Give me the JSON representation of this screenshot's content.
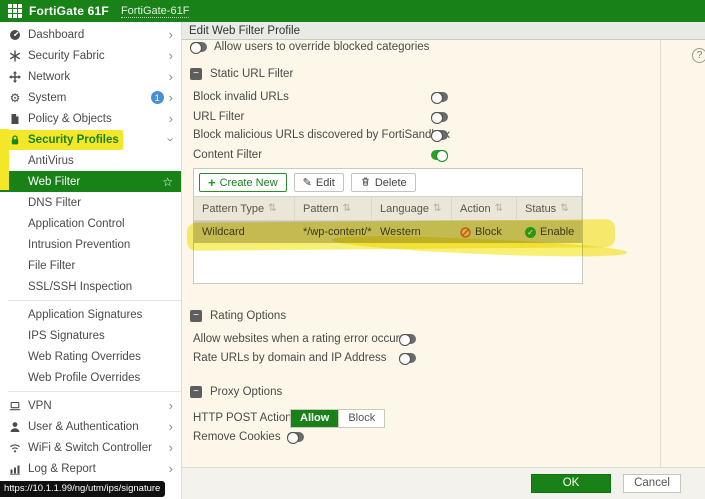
{
  "topbar": {
    "product": "FortiGate 61F",
    "hostname": "FortiGate-61F"
  },
  "sidebar": {
    "items": [
      {
        "label": "Dashboard"
      },
      {
        "label": "Security Fabric"
      },
      {
        "label": "Network"
      },
      {
        "label": "System",
        "badge": "1"
      },
      {
        "label": "Policy & Objects"
      },
      {
        "label": "Security Profiles"
      },
      {
        "label": "AntiVirus"
      },
      {
        "label": "Web Filter"
      },
      {
        "label": "DNS Filter"
      },
      {
        "label": "Application Control"
      },
      {
        "label": "Intrusion Prevention"
      },
      {
        "label": "File Filter"
      },
      {
        "label": "SSL/SSH Inspection"
      },
      {
        "label": "Application Signatures"
      },
      {
        "label": "IPS Signatures"
      },
      {
        "label": "Web Rating Overrides"
      },
      {
        "label": "Web Profile Overrides"
      },
      {
        "label": "VPN"
      },
      {
        "label": "User & Authentication"
      },
      {
        "label": "WiFi & Switch Controller"
      },
      {
        "label": "Log & Report"
      }
    ]
  },
  "page": {
    "title": "Edit Web Filter Profile"
  },
  "override_row": {
    "label": "Allow users to override blocked categories",
    "state": "off"
  },
  "static_url_filter": {
    "title": "Static URL Filter",
    "fields": [
      {
        "label": "Block invalid URLs",
        "state": "off"
      },
      {
        "label": "URL Filter",
        "state": "off"
      },
      {
        "label": "Block malicious URLs discovered by FortiSandbox",
        "state": "off"
      },
      {
        "label": "Content Filter",
        "state": "on"
      }
    ]
  },
  "url_table": {
    "toolbar": {
      "create": "Create New",
      "edit": "Edit",
      "delete": "Delete"
    },
    "columns": [
      "Pattern Type",
      "Pattern",
      "Language",
      "Action",
      "Status"
    ],
    "row": {
      "pattern_type": "Wildcard",
      "pattern": "*/wp-content/*",
      "language": "Western",
      "action": "Block",
      "status": "Enable"
    }
  },
  "rating_options": {
    "title": "Rating Options",
    "fields": [
      {
        "label": "Allow websites when a rating error occurs",
        "state": "off"
      },
      {
        "label": "Rate URLs by domain and IP Address",
        "state": "off"
      }
    ]
  },
  "proxy_options": {
    "title": "Proxy Options",
    "http_post": {
      "label": "HTTP POST Action",
      "options": [
        "Allow",
        "Block"
      ],
      "selected": "Allow"
    },
    "remove_cookies": {
      "label": "Remove Cookies",
      "state": "off"
    }
  },
  "footer": {
    "ok": "OK",
    "cancel": "Cancel"
  },
  "statusbar": {
    "url": "https://10.1.1.99/ng/utm/ips/signature"
  },
  "icons": {
    "chevron_right": "›",
    "star": "☆",
    "gear": "⚙",
    "sort": "⇅",
    "collapse": "−",
    "plus": "+",
    "pencil": "✎",
    "check": "✓",
    "help": "?"
  },
  "colors": {
    "header_green": "#188218",
    "toggle_on_green": "#28a228",
    "highlight_yellow": "#f4e72a",
    "action_block_red": "#d9601e",
    "status_enable_green": "#2e9e2e",
    "badge_blue": "#4a8fd2"
  }
}
